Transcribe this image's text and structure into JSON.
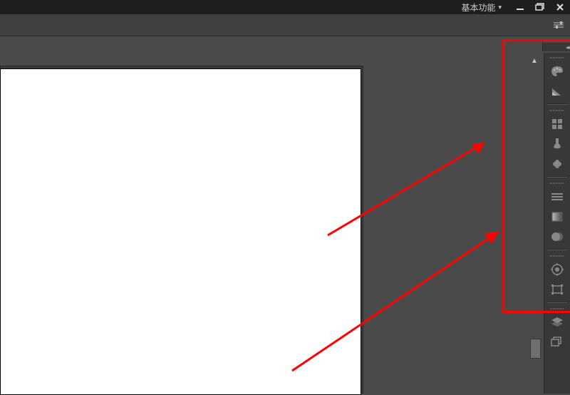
{
  "titlebar": {
    "workspace_label": "基本功能",
    "min_tip": "Minimize",
    "max_tip": "Restore",
    "close_tip": "Close"
  },
  "dock": {
    "items": [
      {
        "name": "color-palette-icon"
      },
      {
        "name": "swatches-icon"
      },
      {
        "name": "grid-icon"
      },
      {
        "name": "brush-icon"
      },
      {
        "name": "clone-icon"
      },
      {
        "name": "stroke-icon"
      },
      {
        "name": "gradient-icon"
      },
      {
        "name": "transparency-icon"
      },
      {
        "name": "appearance-icon"
      },
      {
        "name": "transform-icon"
      },
      {
        "name": "layers-icon"
      },
      {
        "name": "artboards-icon"
      }
    ]
  }
}
